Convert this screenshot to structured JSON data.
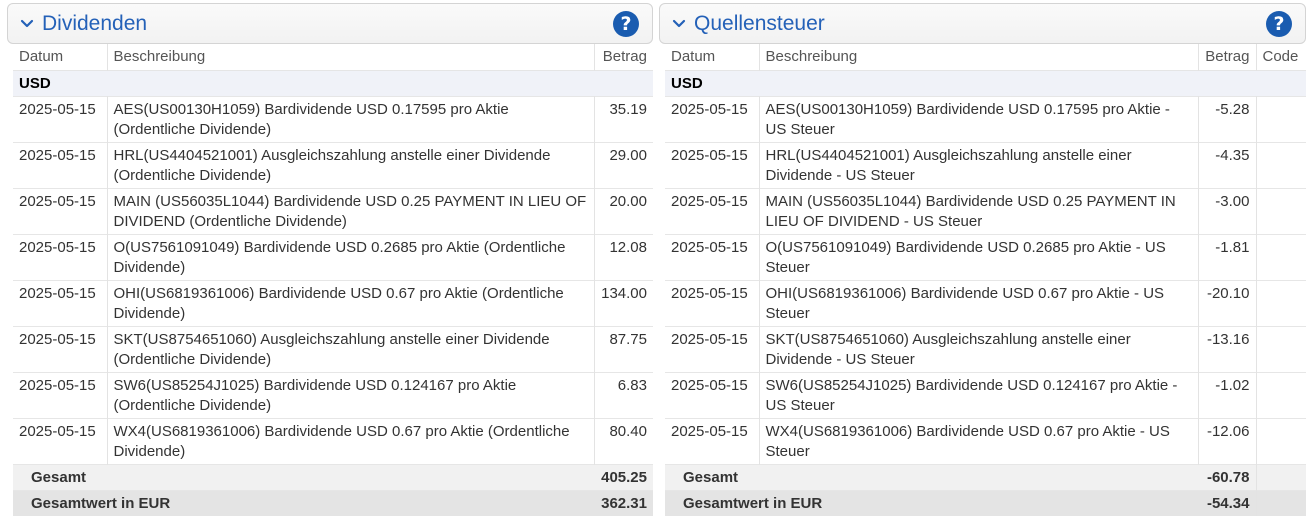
{
  "dividends": {
    "title": "Dividenden",
    "help": "?",
    "columns": {
      "date": "Datum",
      "description": "Beschreibung",
      "amount": "Betrag"
    },
    "group": "USD",
    "rows": [
      {
        "date": "2025-05-15",
        "description": "AES(US00130H1059) Bardividende USD 0.17595 pro Aktie (Ordentliche Dividende)",
        "amount": "35.19"
      },
      {
        "date": "2025-05-15",
        "description": "HRL(US4404521001) Ausgleichszahlung anstelle einer Dividende (Ordentliche Dividende)",
        "amount": "29.00"
      },
      {
        "date": "2025-05-15",
        "description": "MAIN (US56035L1044) Bardividende USD 0.25 PAYMENT IN LIEU OF DIVIDEND (Ordentliche Dividende)",
        "amount": "20.00"
      },
      {
        "date": "2025-05-15",
        "description": "O(US7561091049) Bardividende USD 0.2685 pro Aktie (Ordentliche Dividende)",
        "amount": "12.08"
      },
      {
        "date": "2025-05-15",
        "description": "OHI(US6819361006) Bardividende USD 0.67 pro Aktie (Ordentliche Dividende)",
        "amount": "134.00"
      },
      {
        "date": "2025-05-15",
        "description": "SKT(US8754651060) Ausgleichszahlung anstelle einer Dividende (Ordentliche Dividende)",
        "amount": "87.75"
      },
      {
        "date": "2025-05-15",
        "description": "SW6(US85254J1025) Bardividende USD 0.124167 pro Aktie (Ordentliche Dividende)",
        "amount": "6.83"
      },
      {
        "date": "2025-05-15",
        "description": "WX4(US6819361006) Bardividende USD 0.67 pro Aktie (Ordentliche Dividende)",
        "amount": "80.40"
      }
    ],
    "total_label": "Gesamt",
    "total_value": "405.25",
    "eur_label": "Gesamtwert in EUR",
    "eur_value": "362.31"
  },
  "withholding": {
    "title": "Quellensteuer",
    "help": "?",
    "columns": {
      "date": "Datum",
      "description": "Beschreibung",
      "amount": "Betrag",
      "code": "Code"
    },
    "group": "USD",
    "rows": [
      {
        "date": "2025-05-15",
        "description": "AES(US00130H1059) Bardividende USD 0.17595 pro Aktie - US Steuer",
        "amount": "-5.28",
        "code": ""
      },
      {
        "date": "2025-05-15",
        "description": "HRL(US4404521001) Ausgleichszahlung anstelle einer Dividende - US Steuer",
        "amount": "-4.35",
        "code": ""
      },
      {
        "date": "2025-05-15",
        "description": "MAIN (US56035L1044) Bardividende USD 0.25 PAYMENT IN LIEU OF DIVIDEND - US Steuer",
        "amount": "-3.00",
        "code": ""
      },
      {
        "date": "2025-05-15",
        "description": "O(US7561091049) Bardividende USD 0.2685 pro Aktie - US Steuer",
        "amount": "-1.81",
        "code": ""
      },
      {
        "date": "2025-05-15",
        "description": "OHI(US6819361006) Bardividende USD 0.67 pro Aktie - US Steuer",
        "amount": "-20.10",
        "code": ""
      },
      {
        "date": "2025-05-15",
        "description": "SKT(US8754651060) Ausgleichszahlung anstelle einer Dividende - US Steuer",
        "amount": "-13.16",
        "code": ""
      },
      {
        "date": "2025-05-15",
        "description": "SW6(US85254J1025) Bardividende USD 0.124167 pro Aktie - US Steuer",
        "amount": "-1.02",
        "code": ""
      },
      {
        "date": "2025-05-15",
        "description": "WX4(US6819361006) Bardividende USD 0.67 pro Aktie - US Steuer",
        "amount": "-12.06",
        "code": ""
      }
    ],
    "total_label": "Gesamt",
    "total_value": "-60.78",
    "eur_label": "Gesamtwert in EUR",
    "eur_value": "-54.34"
  },
  "icons": {
    "collapse": "chevron-down-icon",
    "help": "help-icon"
  },
  "colors": {
    "title": "#2461b8",
    "help_button": "#1a5cb0",
    "group_bg": "#f0f2f8"
  }
}
